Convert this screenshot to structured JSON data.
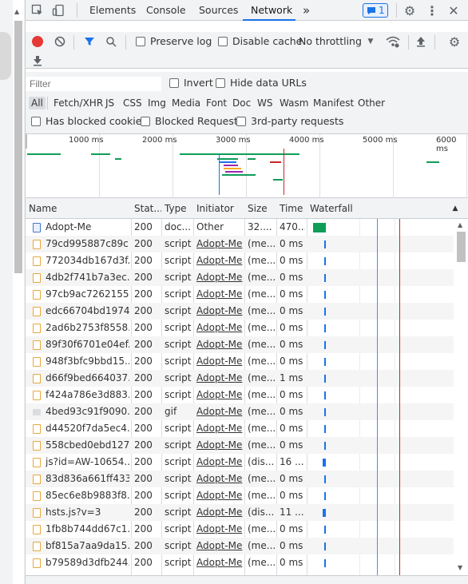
{
  "tabs": [
    "Elements",
    "Console",
    "Sources",
    "Network"
  ],
  "selected_tab": "Network",
  "more_tabs_glyph": "»",
  "issues_count": "1",
  "toolbar": {
    "preserve_log": "Preserve log",
    "disable_cache": "Disable cache",
    "throttling": "No throttling"
  },
  "filter": {
    "placeholder": "Filter",
    "invert": "Invert",
    "hide_data_urls": "Hide data URLs",
    "types": [
      "All",
      "Fetch/XHR",
      "JS",
      "CSS",
      "Img",
      "Media",
      "Font",
      "Doc",
      "WS",
      "Wasm",
      "Manifest",
      "Other"
    ],
    "selected_type": "All",
    "has_blocked_cookies": "Has blocked cookies",
    "blocked_requests": "Blocked Requests",
    "third_party": "3rd-party requests"
  },
  "overview": {
    "ticks": [
      "1000 ms",
      "2000 ms",
      "3000 ms",
      "4000 ms",
      "5000 ms",
      "6000 ms"
    ]
  },
  "columns": [
    "Name",
    "Stat...",
    "Type",
    "Initiator",
    "Size",
    "Time",
    "Waterfall"
  ],
  "rows": [
    {
      "name": "Adopt-Me",
      "status": "200",
      "type": "doc...",
      "initiator": "Other",
      "init_link": false,
      "size": "32....",
      "time": "470...",
      "icon": "doc"
    },
    {
      "name": "79cd995887c89c...",
      "status": "200",
      "type": "script",
      "initiator": "Adopt-Me",
      "init_link": true,
      "size": "(me...",
      "time": "0 ms",
      "icon": "script"
    },
    {
      "name": "772034db167d3f...",
      "status": "200",
      "type": "script",
      "initiator": "Adopt-Me",
      "init_link": true,
      "size": "(me...",
      "time": "0 ms",
      "icon": "script"
    },
    {
      "name": "4db2f741b7a3ec...",
      "status": "200",
      "type": "script",
      "initiator": "Adopt-Me",
      "init_link": true,
      "size": "(me...",
      "time": "0 ms",
      "icon": "script"
    },
    {
      "name": "97cb9ac7262155...",
      "status": "200",
      "type": "script",
      "initiator": "Adopt-Me",
      "init_link": true,
      "size": "(me...",
      "time": "0 ms",
      "icon": "script"
    },
    {
      "name": "edc66704bd1974...",
      "status": "200",
      "type": "script",
      "initiator": "Adopt-Me",
      "init_link": true,
      "size": "(me...",
      "time": "0 ms",
      "icon": "script"
    },
    {
      "name": "2ad6b2753f8558...",
      "status": "200",
      "type": "script",
      "initiator": "Adopt-Me",
      "init_link": true,
      "size": "(me...",
      "time": "0 ms",
      "icon": "script"
    },
    {
      "name": "89f30f6701e04ef...",
      "status": "200",
      "type": "script",
      "initiator": "Adopt-Me",
      "init_link": true,
      "size": "(me...",
      "time": "0 ms",
      "icon": "script"
    },
    {
      "name": "948f3bfc9bbd15...",
      "status": "200",
      "type": "script",
      "initiator": "Adopt-Me",
      "init_link": true,
      "size": "(me...",
      "time": "0 ms",
      "icon": "script"
    },
    {
      "name": "d66f9bed664037...",
      "status": "200",
      "type": "script",
      "initiator": "Adopt-Me",
      "init_link": true,
      "size": "(me...",
      "time": "1 ms",
      "icon": "script"
    },
    {
      "name": "f424a786e3d883...",
      "status": "200",
      "type": "script",
      "initiator": "Adopt-Me",
      "init_link": true,
      "size": "(me...",
      "time": "0 ms",
      "icon": "script"
    },
    {
      "name": "4bed93c91f9090...",
      "status": "200",
      "type": "gif",
      "initiator": "Adopt-Me",
      "init_link": true,
      "size": "(me...",
      "time": "0 ms",
      "icon": "gif"
    },
    {
      "name": "d44520f7da5ec4...",
      "status": "200",
      "type": "script",
      "initiator": "Adopt-Me",
      "init_link": true,
      "size": "(me...",
      "time": "0 ms",
      "icon": "script"
    },
    {
      "name": "558cbed0ebd127...",
      "status": "200",
      "type": "script",
      "initiator": "Adopt-Me",
      "init_link": true,
      "size": "(me...",
      "time": "0 ms",
      "icon": "script"
    },
    {
      "name": "js?id=AW-10654...",
      "status": "200",
      "type": "script",
      "initiator": "Adopt-Me",
      "init_link": true,
      "size": "(dis...",
      "time": "16 ...",
      "icon": "script"
    },
    {
      "name": "83d836a661ff433...",
      "status": "200",
      "type": "script",
      "initiator": "Adopt-Me",
      "init_link": true,
      "size": "(me...",
      "time": "0 ms",
      "icon": "script"
    },
    {
      "name": "85ec6e8b9883f8...",
      "status": "200",
      "type": "script",
      "initiator": "Adopt-Me",
      "init_link": true,
      "size": "(me...",
      "time": "0 ms",
      "icon": "script"
    },
    {
      "name": "hsts.js?v=3",
      "status": "200",
      "type": "script",
      "initiator": "Adopt-Me",
      "init_link": true,
      "size": "(dis...",
      "time": "11 ...",
      "icon": "script"
    },
    {
      "name": "1fb8b744dd67c1...",
      "status": "200",
      "type": "script",
      "initiator": "Adopt-Me",
      "init_link": true,
      "size": "(me...",
      "time": "0 ms",
      "icon": "script"
    },
    {
      "name": "bf815a7aa9da15...",
      "status": "200",
      "type": "script",
      "initiator": "Adopt-Me",
      "init_link": true,
      "size": "(me...",
      "time": "0 ms",
      "icon": "script"
    },
    {
      "name": "b79589d3dfb244...",
      "status": "200",
      "type": "script",
      "initiator": "Adopt-Me",
      "init_link": true,
      "size": "(me...",
      "time": "0 ms",
      "icon": "script"
    }
  ],
  "colors": {
    "record": "#e53935",
    "accent": "#1a73e8",
    "waterfall_doc": "#0f9d58",
    "waterfall_script": "#1a73e8",
    "dom_content_loaded": "#4a90d9",
    "load": "#c62828"
  }
}
